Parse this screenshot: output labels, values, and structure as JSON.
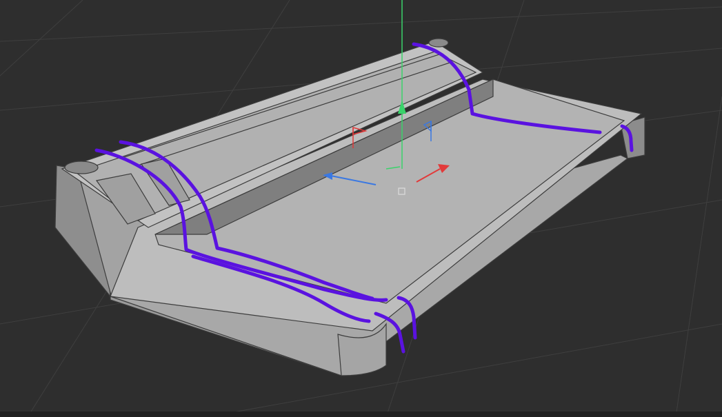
{
  "viewport": {
    "background": "#2e2e2e",
    "grid_color": "#3f3f3f",
    "model_light": "#bdbdbd",
    "model_mid": "#a9a9a9",
    "model_dark": "#7d7d7d",
    "model_edge": "#3c3c3c",
    "markup_color": "#5a12e0",
    "axis_x_color": "#e23a3a",
    "axis_y_color": "#3ad36a",
    "axis_z_color": "#3a78e2"
  },
  "icons": {
    "gizmo": "transform-gizmo-icon",
    "light_red": "flag-icon",
    "light_blue": "flag-icon",
    "origin": "cube-icon"
  }
}
